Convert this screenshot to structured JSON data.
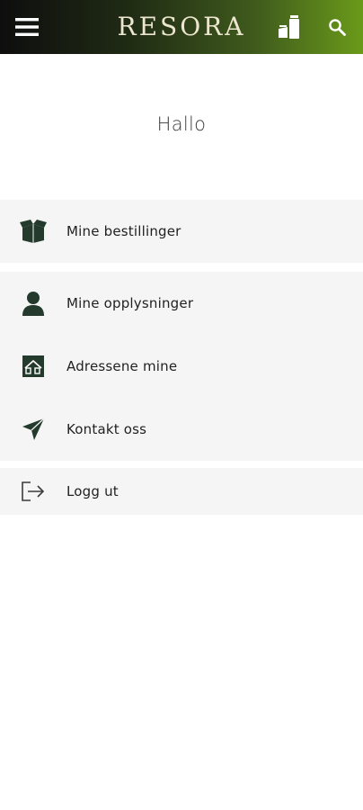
{
  "header": {
    "brand": "RESORA",
    "menu_icon": "hamburger-menu-icon",
    "products_icon": "bottles-icon",
    "search_icon": "search-icon",
    "background_start": "#0e0e0e",
    "background_end": "#6a9a1a",
    "brand_color": "#ede6cf"
  },
  "greeting": "Hallo",
  "menu": {
    "orders": {
      "label": "Mine bestillinger",
      "icon": "package-icon"
    },
    "details": {
      "label": "Mine opplysninger",
      "icon": "person-icon"
    },
    "addresses": {
      "label": "Adressene mine",
      "icon": "house-icon"
    },
    "contact": {
      "label": "Kontakt oss",
      "icon": "paper-plane-icon"
    },
    "logout": {
      "label": "Logg ut",
      "icon": "logout-icon"
    }
  },
  "colors": {
    "icon": "#233a2c",
    "row_background": "#f5f5f5",
    "text": "#222222"
  }
}
